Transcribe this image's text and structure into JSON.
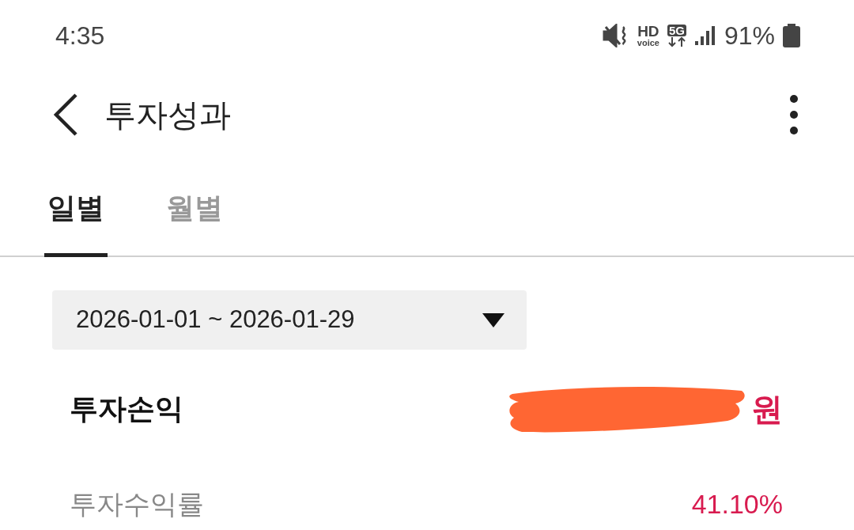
{
  "status_bar": {
    "time": "4:35",
    "hd_label": "HD",
    "voice_label": "voice",
    "network_label": "5G",
    "battery": "91%"
  },
  "header": {
    "title": "투자성과"
  },
  "tabs": [
    {
      "label": "일별",
      "selected": true
    },
    {
      "label": "월별",
      "selected": false
    }
  ],
  "period_select": {
    "value": "2026-01-01 ~ 2026-01-29"
  },
  "summary": [
    {
      "label": "투자손익",
      "value": "원",
      "redacted": true,
      "emphasis": true
    },
    {
      "label": "투자수익률",
      "value": "41.10%",
      "redacted": false,
      "emphasis": false
    }
  ]
}
